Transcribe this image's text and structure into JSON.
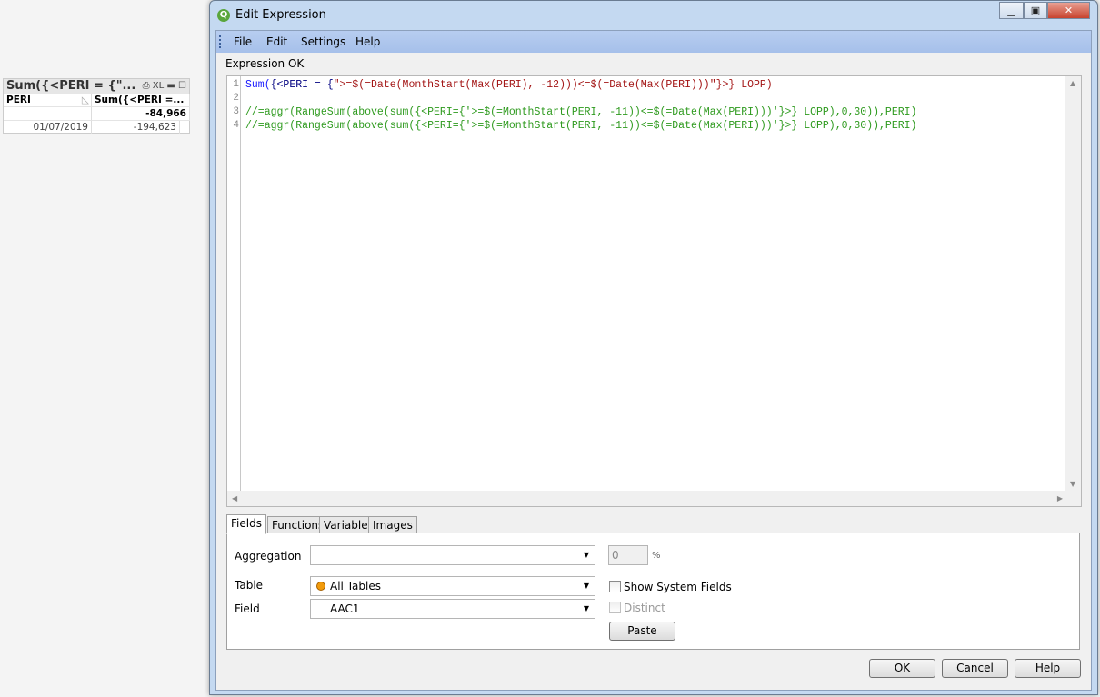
{
  "table_box": {
    "caption": "Sum({<PERI = {\"...",
    "caption_icons": [
      "print-icon",
      "XL",
      "minimize-icon",
      "maximize-icon"
    ],
    "headers": [
      "PERI",
      "Sum({<PERI =..."
    ],
    "total": "-84,966",
    "rows": [
      {
        "peri": "01/07/2019",
        "value": "-194,623"
      }
    ]
  },
  "dialog": {
    "title": "Edit Expression",
    "logo": "Q",
    "menu": [
      "File",
      "Edit",
      "Settings",
      "Help"
    ],
    "status": "Expression OK",
    "lines": [
      {
        "n": "1",
        "parts": [
          "Sum(",
          "{<PERI = {",
          "\">=$(=Date(MonthStart(Max(PERI), -12)))<=$(=Date(Max(PERI)))\"}>} LOPP)"
        ]
      },
      {
        "n": "2",
        "text": ""
      },
      {
        "n": "3",
        "text": "//=aggr(RangeSum(above(sum({<PERI={'>=$(=MonthStart(PERI, -11))<=$(=Date(Max(PERI)))'}>} LOPP),0,30)),PERI)"
      },
      {
        "n": "4",
        "text": "//=aggr(RangeSum(above(sum({<PERI={'>=$(=MonthStart(PERI, -11))<=$(=Date(Max(PERI)))'}>} LOPP),0,30)),PERI)"
      }
    ],
    "tabs": [
      "Fields",
      "Functions",
      "Variables",
      "Images"
    ],
    "fields": {
      "aggregation_label": "Aggregation",
      "aggregation_value": "",
      "percent_value": "0",
      "percent_sign": "%",
      "table_label": "Table",
      "table_value": "All Tables",
      "field_label": "Field",
      "field_value": "AAC1",
      "show_system_fields": "Show System Fields",
      "distinct": "Distinct",
      "paste": "Paste"
    },
    "buttons": {
      "ok": "OK",
      "cancel": "Cancel",
      "help": "Help"
    }
  }
}
